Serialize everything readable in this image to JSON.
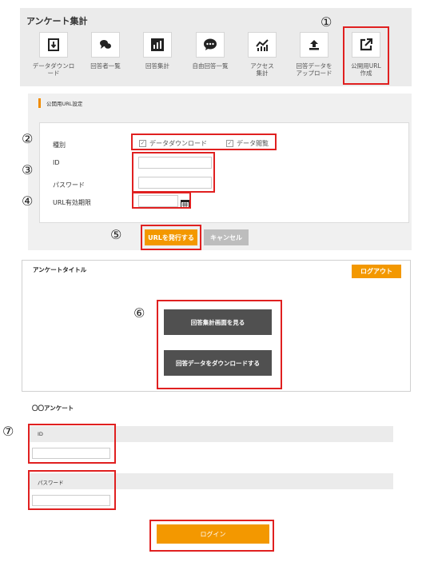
{
  "markers": [
    "①",
    "②",
    "③",
    "④",
    "⑤",
    "⑥",
    "⑦"
  ],
  "survey_admin": {
    "title": "アンケート集計",
    "tools": [
      {
        "label": "データダウンロ\nード",
        "icon": "download-doc-icon"
      },
      {
        "label": "回答者一覧",
        "icon": "chat-bubbles-icon"
      },
      {
        "label": "回答集計",
        "icon": "bar-chart-icon"
      },
      {
        "label": "自由回答一覧",
        "icon": "speech-bubble-icon"
      },
      {
        "label": "アクセス\n集計",
        "icon": "line-chart-icon"
      },
      {
        "label": "回答データを\nアップロード",
        "icon": "upload-icon"
      },
      {
        "label": "公開用URL\n作成",
        "icon": "external-link-icon"
      }
    ]
  },
  "url_settings": {
    "section_title": "公開用URL設定",
    "type_label": "種別",
    "option_download": "データダウンロード",
    "option_view": "データ閲覧",
    "id_label": "ID",
    "password_label": "パスワード",
    "expiry_label": "URL有効期限",
    "issue_button": "URLを発行する",
    "cancel_button": "キャンセル"
  },
  "public_view": {
    "title": "アンケートタイトル",
    "logout_button": "ログアウト",
    "view_results_button": "回答集計画面を見る",
    "download_button": "回答データをダウンロードする"
  },
  "login": {
    "title": "〇〇アンケート",
    "id_label": "ID",
    "password_label": "パスワード",
    "login_button": "ログイン"
  },
  "colors": {
    "accent": "#f39800",
    "highlight": "#e02020",
    "dark_button": "#505050"
  }
}
